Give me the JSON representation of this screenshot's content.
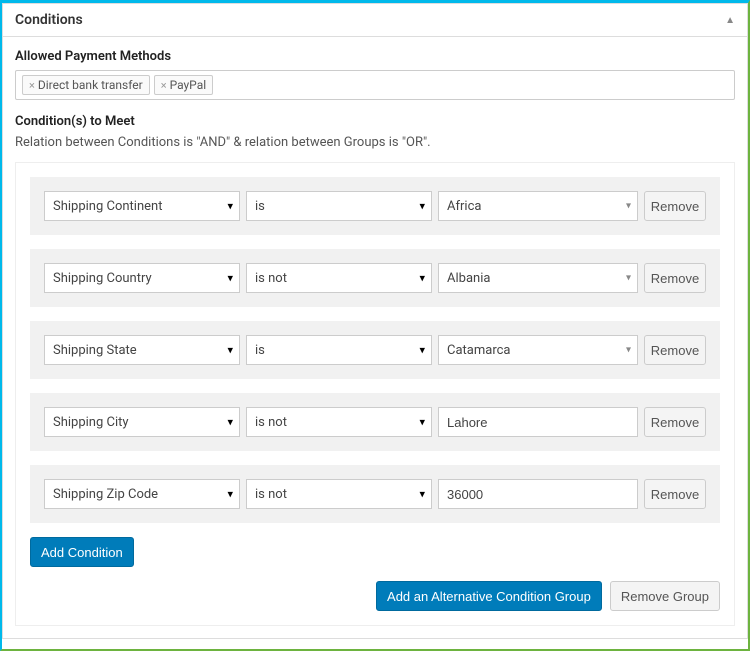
{
  "panel": {
    "title": "Conditions"
  },
  "allowed": {
    "label": "Allowed Payment Methods",
    "tags": [
      "Direct bank transfer",
      "PayPal"
    ]
  },
  "conditions": {
    "label": "Condition(s) to Meet",
    "help": "Relation between Conditions is \"AND\" & relation between Groups is \"OR\".",
    "rules": [
      {
        "field": "Shipping Continent",
        "op": "is",
        "value": "Africa",
        "vtype": "combo"
      },
      {
        "field": "Shipping Country",
        "op": "is not",
        "value": "Albania",
        "vtype": "combo"
      },
      {
        "field": "Shipping State",
        "op": "is",
        "value": "Catamarca",
        "vtype": "combo"
      },
      {
        "field": "Shipping City",
        "op": "is not",
        "value": "Lahore",
        "vtype": "text"
      },
      {
        "field": "Shipping Zip Code",
        "op": "is not",
        "value": "36000",
        "vtype": "text"
      }
    ],
    "remove_label": "Remove",
    "add_label": "Add Condition",
    "add_group_label": "Add an Alternative Condition Group",
    "remove_group_label": "Remove Group"
  }
}
